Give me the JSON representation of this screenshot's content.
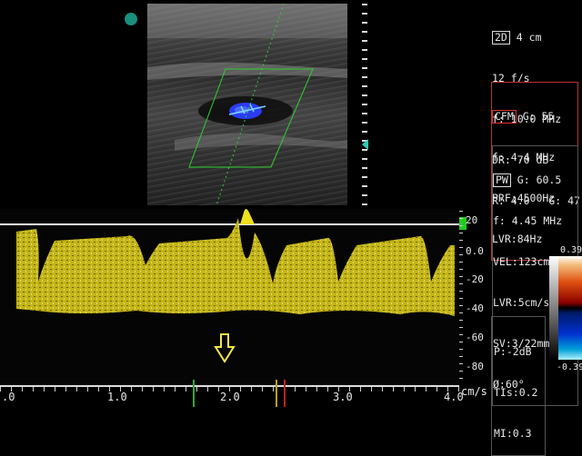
{
  "mode_2d": {
    "header": "2D",
    "depth": "4 cm",
    "lines": [
      "12 f/s",
      "f: 10.0 MHz",
      "DR: 70 dB",
      "R: 4.0   G: 47"
    ]
  },
  "mode_cfm": {
    "header": "CFM",
    "gain": "G: 55",
    "lines": [
      "f: 4.4 MHz",
      "PRF:4500Hz",
      "LVR:84Hz"
    ]
  },
  "mode_pw": {
    "header": "PW",
    "gain": "G: 60.5",
    "lines": [
      "f: 4.45 MHz",
      "VEL:123cm/s",
      "LVR:5cm/s",
      "SV:3/22mm",
      "Ø:60°"
    ]
  },
  "safety": {
    "lines": [
      "P:-2dB",
      "TIs:0.2",
      "MI:0.3"
    ]
  },
  "colorbar": {
    "max": "0.39",
    "min": "-0.39"
  },
  "velocity_axis": {
    "unit": "cm/s",
    "ticks": [
      "20",
      "0.0",
      "-20",
      "-40",
      "-60",
      "-80"
    ]
  },
  "time_axis": {
    "ticks": [
      ".0",
      "1.0",
      "2.0",
      "3.0",
      "4.0"
    ]
  },
  "colors": {
    "doppler": "#f0e020",
    "roi": "#2fd02f",
    "cfm_frame": "#b33333",
    "arrow": "#f3e84a"
  }
}
